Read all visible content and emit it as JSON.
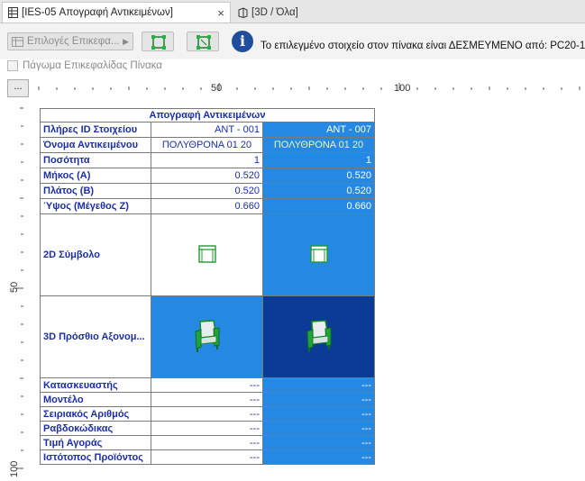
{
  "tabs": [
    {
      "label": "[IES-05 Απογραφή Αντικειμένων]",
      "icon": "schedule-icon",
      "active": true
    },
    {
      "label": "[3D / Όλα]",
      "icon": "3d-window-icon",
      "active": false
    }
  ],
  "tab_close": "×",
  "toolbar": {
    "options_label": "Επιλογές Επικεφα...",
    "info_icon": "i",
    "info_text": "Το επιλεγμένο στοιχείο στον πίνακα είναι ΔΕΣΜΕΥΜΕΝΟ από: PC20-1.",
    "freeze_label": "Πάγωμα Επικεφαλίδας Πίνακα"
  },
  "ruler": {
    "corner": "...",
    "h_labels": [
      "50",
      "100"
    ],
    "v_labels": [
      "50",
      "100"
    ]
  },
  "schedule": {
    "title": "Απογραφή Αντικειμένων",
    "rows": [
      {
        "label": "Πλήρες ID Στοιχείου",
        "v1": "ΑΝΤ - 001",
        "v2": "ΑΝΤ - 007"
      },
      {
        "label": "Όνομα Αντικειμένου",
        "v1": "ΠΟΛΥΘΡΟΝΑ 01 20",
        "v2": "ΠΟΛΥΘΡΟΝΑ 01 20"
      },
      {
        "label": "Ποσότητα",
        "v1": "1",
        "v2": "1"
      },
      {
        "label": "Μήκος (A)",
        "v1": "0.520",
        "v2": "0.520"
      },
      {
        "label": "Πλάτος (B)",
        "v1": "0.520",
        "v2": "0.520"
      },
      {
        "label": "Ύψος (Μέγεθος Ζ)",
        "v1": "0.660",
        "v2": "0.660"
      }
    ],
    "symbol_label": "2D Σύμβολο",
    "axon_label": "3D Πρόσθιο Αξονομ...",
    "rows_bottom": [
      {
        "label": "Κατασκευαστής",
        "v1": "---",
        "v2": "---"
      },
      {
        "label": "Μοντέλο",
        "v1": "---",
        "v2": "---"
      },
      {
        "label": "Σειριακός Αριθμός",
        "v1": "---",
        "v2": "---"
      },
      {
        "label": "Ραβδοκώδικας",
        "v1": "---",
        "v2": "---"
      },
      {
        "label": "Τιμή Αγοράς",
        "v1": "---",
        "v2": "---"
      },
      {
        "label": "Ιστότοπος Προϊόντος",
        "v1": "---",
        "v2": "---"
      }
    ]
  },
  "colors": {
    "selected_column": "#2588e3",
    "selected_image_cell": "#0b3b97",
    "label_text": "#1a2fa6",
    "symbol_green": "#1e9a2e"
  }
}
